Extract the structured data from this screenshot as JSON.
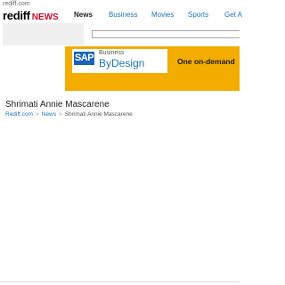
{
  "top_link": "rediff.com",
  "logo": {
    "part1": "rediff",
    "part2": "NEWS"
  },
  "nav": {
    "items": [
      {
        "label": "News",
        "active": true
      },
      {
        "label": "Business"
      },
      {
        "label": "Movies"
      },
      {
        "label": "Sports"
      },
      {
        "label": "Get A"
      }
    ]
  },
  "ad": {
    "brand": "SAP",
    "line1": "Business",
    "line2": "ByDesign",
    "tagline": "One on-demand"
  },
  "page": {
    "title": "Shrimati Annie Mascarene"
  },
  "breadcrumb": {
    "home": "Rediff.com",
    "section": "News",
    "separator": ">",
    "current": "Shrimati Annie Mascarene"
  }
}
